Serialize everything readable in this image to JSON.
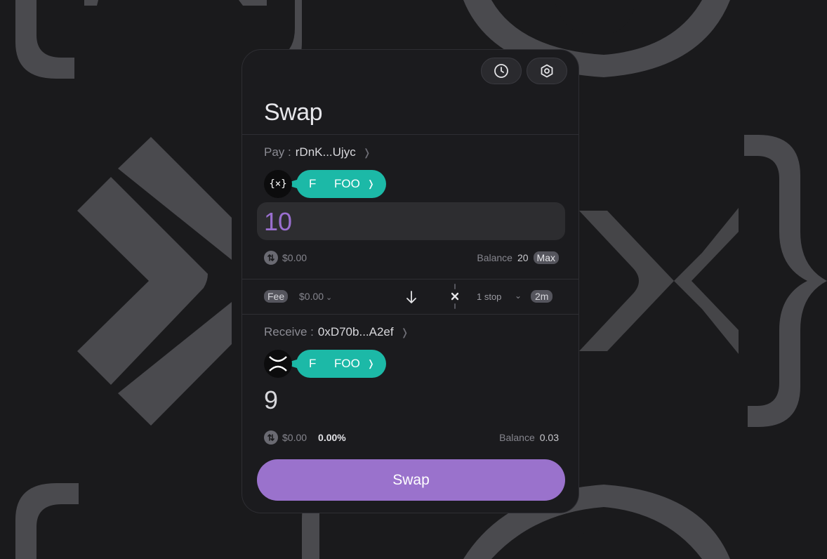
{
  "colors": {
    "accent": "#9a72cc",
    "token": "#1cb9a7",
    "background": "#1a1a1c"
  },
  "header": {
    "history_icon": "clock-icon",
    "settings_icon": "hexagon-gear-icon"
  },
  "title": "Swap",
  "pay": {
    "label": "Pay :",
    "address": "rDnK...Ujyc",
    "chain_icon": "curly-x-icon",
    "chain_glyph": "{×}",
    "token_letter": "F",
    "token_symbol": "FOO",
    "amount": "10",
    "usd": "$0.00",
    "balance_label": "Balance",
    "balance_value": "20",
    "max_label": "Max"
  },
  "middle": {
    "fee_label": "Fee",
    "fee_value": "$0.00",
    "stops": "1 stop",
    "time": "2m"
  },
  "receive": {
    "label": "Receive :",
    "address": "0xD70b...A2ef",
    "chain_icon": "x-logo-icon",
    "token_letter": "F",
    "token_symbol": "FOO",
    "amount": "9",
    "usd": "$0.00",
    "price_impact": "0.00%",
    "balance_label": "Balance",
    "balance_value": "0.03"
  },
  "swap_button": "Swap"
}
